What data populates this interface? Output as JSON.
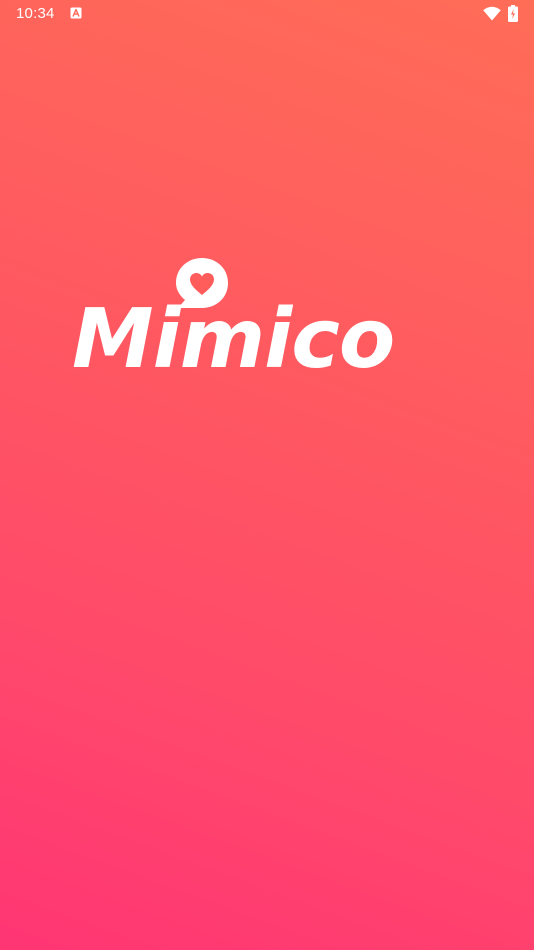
{
  "status_bar": {
    "time": "10:34",
    "notification_icon": "font-a-icon",
    "wifi_icon": "wifi-icon",
    "battery_icon": "battery-charging-icon"
  },
  "splash": {
    "logo_icon": "heart-speech-bubble-icon",
    "app_name": "Mimico"
  },
  "colors": {
    "gradient_top": "#ff6d57",
    "gradient_bottom": "#ff3574",
    "logo": "#ffffff"
  }
}
